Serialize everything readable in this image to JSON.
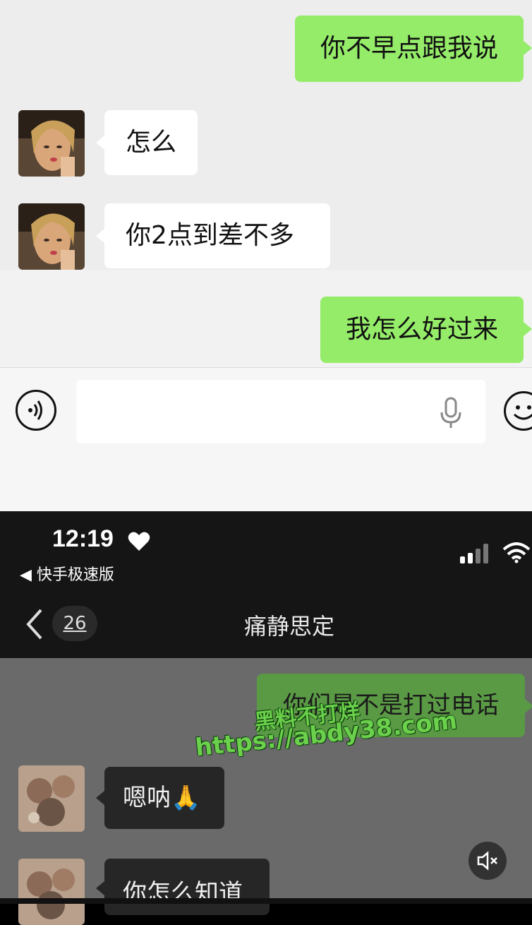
{
  "top_chat": {
    "messages": [
      {
        "side": "me",
        "text": "你不早点跟我说"
      },
      {
        "side": "them",
        "text": "怎么"
      },
      {
        "side": "them",
        "text": "你2点到差不多"
      },
      {
        "side": "me",
        "text": "我怎么好过来"
      }
    ],
    "input": {
      "value": "",
      "voice_icon": "voice-icon",
      "mic_icon": "mic-icon",
      "emoji_icon": "emoji-icon"
    }
  },
  "status_bar": {
    "time": "12:19",
    "back_app": "◀ 快手极速版"
  },
  "header": {
    "unread_count": "26",
    "title": "痛静思定"
  },
  "bottom_chat": {
    "messages": [
      {
        "side": "me",
        "text": "你们是不是打过电话"
      },
      {
        "side": "them",
        "text": "嗯呐🙏"
      },
      {
        "side": "them",
        "text": "你怎么知道"
      }
    ]
  },
  "watermark": {
    "line1": "黑料不打烊",
    "line2": "https://abdy38.com"
  },
  "colors": {
    "my_bubble": "#95ec69",
    "their_bubble": "#ffffff",
    "dark_bg": "#151515"
  }
}
